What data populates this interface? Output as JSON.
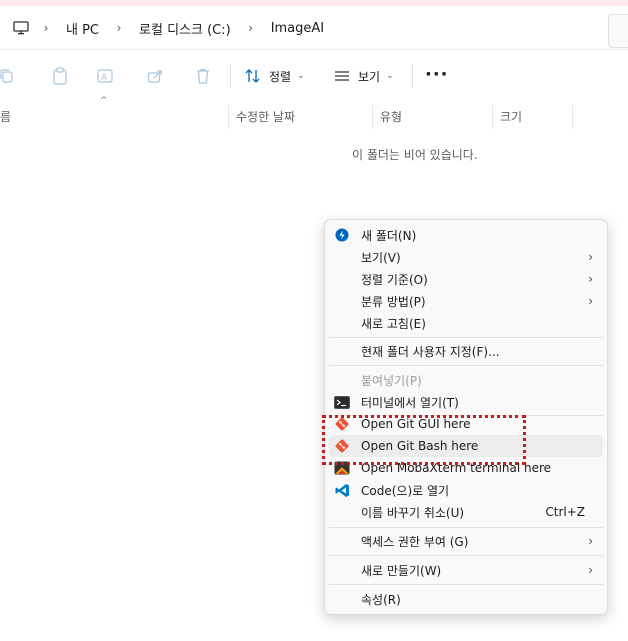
{
  "address": {
    "breadcrumbs": [
      "내 PC",
      "로컬 디스크 (C:)",
      "ImageAI"
    ]
  },
  "toolbar": {
    "sort_label": "정렬",
    "view_label": "보기"
  },
  "columns": [
    "름",
    "수정한 날짜",
    "유형",
    "크기"
  ],
  "empty_message": "이 폴더는 비어 있습니다.",
  "context_menu": {
    "items": [
      {
        "label": "새 폴더(N)",
        "icon": "new-folder-icon"
      },
      {
        "label": "보기(V)",
        "submenu": true
      },
      {
        "label": "정렬 기준(O)",
        "submenu": true
      },
      {
        "label": "분류 방법(P)",
        "submenu": true
      },
      {
        "label": "새로 고침(E)"
      },
      {
        "label": "현재 폴더 사용자 지정(F)..."
      },
      {
        "label": "붙여넣기(P)",
        "disabled": true
      },
      {
        "label": "터미널에서 열기(T)",
        "icon": "terminal-icon"
      },
      {
        "label": "Open Git GUI here",
        "icon": "git-icon"
      },
      {
        "label": "Open Git Bash here",
        "icon": "git-icon",
        "highlighted": true
      },
      {
        "label": "Open MobaXterm terminal here",
        "icon": "mobaxterm-icon"
      },
      {
        "label": "Code(으)로 열기",
        "icon": "vscode-icon"
      },
      {
        "label": "이름 바꾸기 취소(U)",
        "shortcut": "Ctrl+Z"
      },
      {
        "label": "액세스 권한 부여 (G)",
        "submenu": true
      },
      {
        "label": "새로 만들기(W)",
        "submenu": true
      },
      {
        "label": "속성(R)"
      }
    ]
  },
  "colors": {
    "accent": "#0067c0",
    "annotation": "#c41e1e",
    "git": "#f05033",
    "vscode": "#007acc"
  }
}
